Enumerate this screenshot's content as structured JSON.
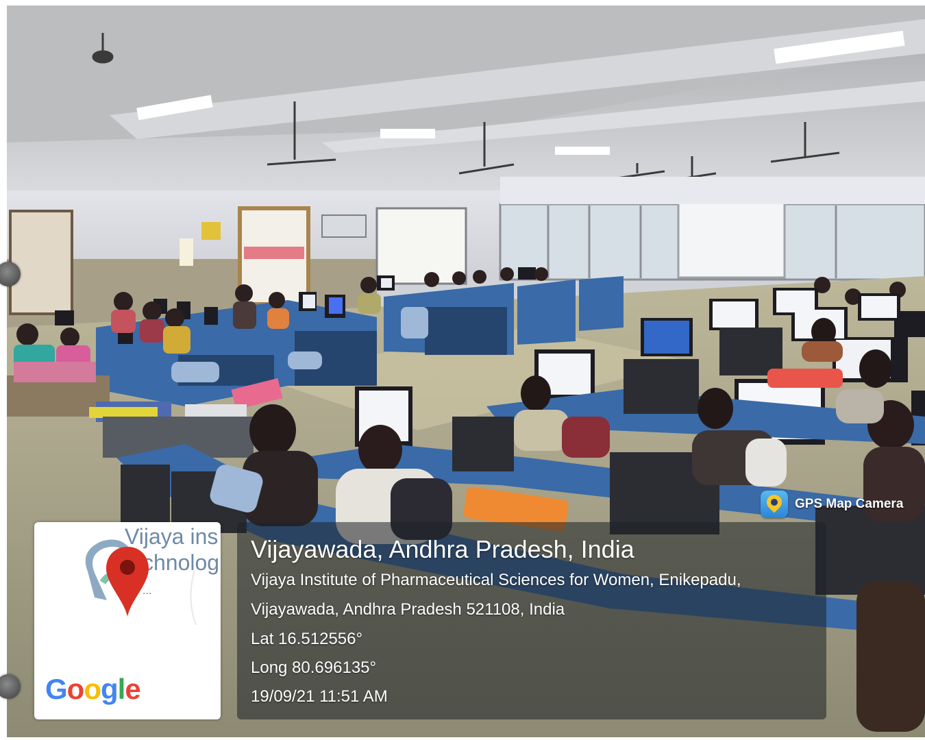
{
  "overlay": {
    "app_badge": {
      "label": "GPS Map Camera",
      "icon": "gps-map-camera-icon"
    },
    "map_thumbnail": {
      "place_label_lines": [
        "Vijaya ins",
        "chnolog"
      ],
      "ellipsis": "...",
      "marker_icon": "red-location-pin-icon",
      "provider_logo": "Google"
    },
    "location": {
      "title": "Vijayawada, Andhra Pradesh, India",
      "address_line_1": "Vijaya Institute of Pharmaceutical Sciences for Women, Enikepadu,",
      "address_line_2": "Vijayawada, Andhra Pradesh 521108, India",
      "latitude": "Lat 16.512556°",
      "longitude": "Long 80.696135°",
      "timestamp": "19/09/21 11:51 AM"
    }
  },
  "colors": {
    "pin_red": "#d93025",
    "panel_bg": "rgba(30,34,38,0.55)",
    "desk_blue": "#3a6aa8"
  }
}
